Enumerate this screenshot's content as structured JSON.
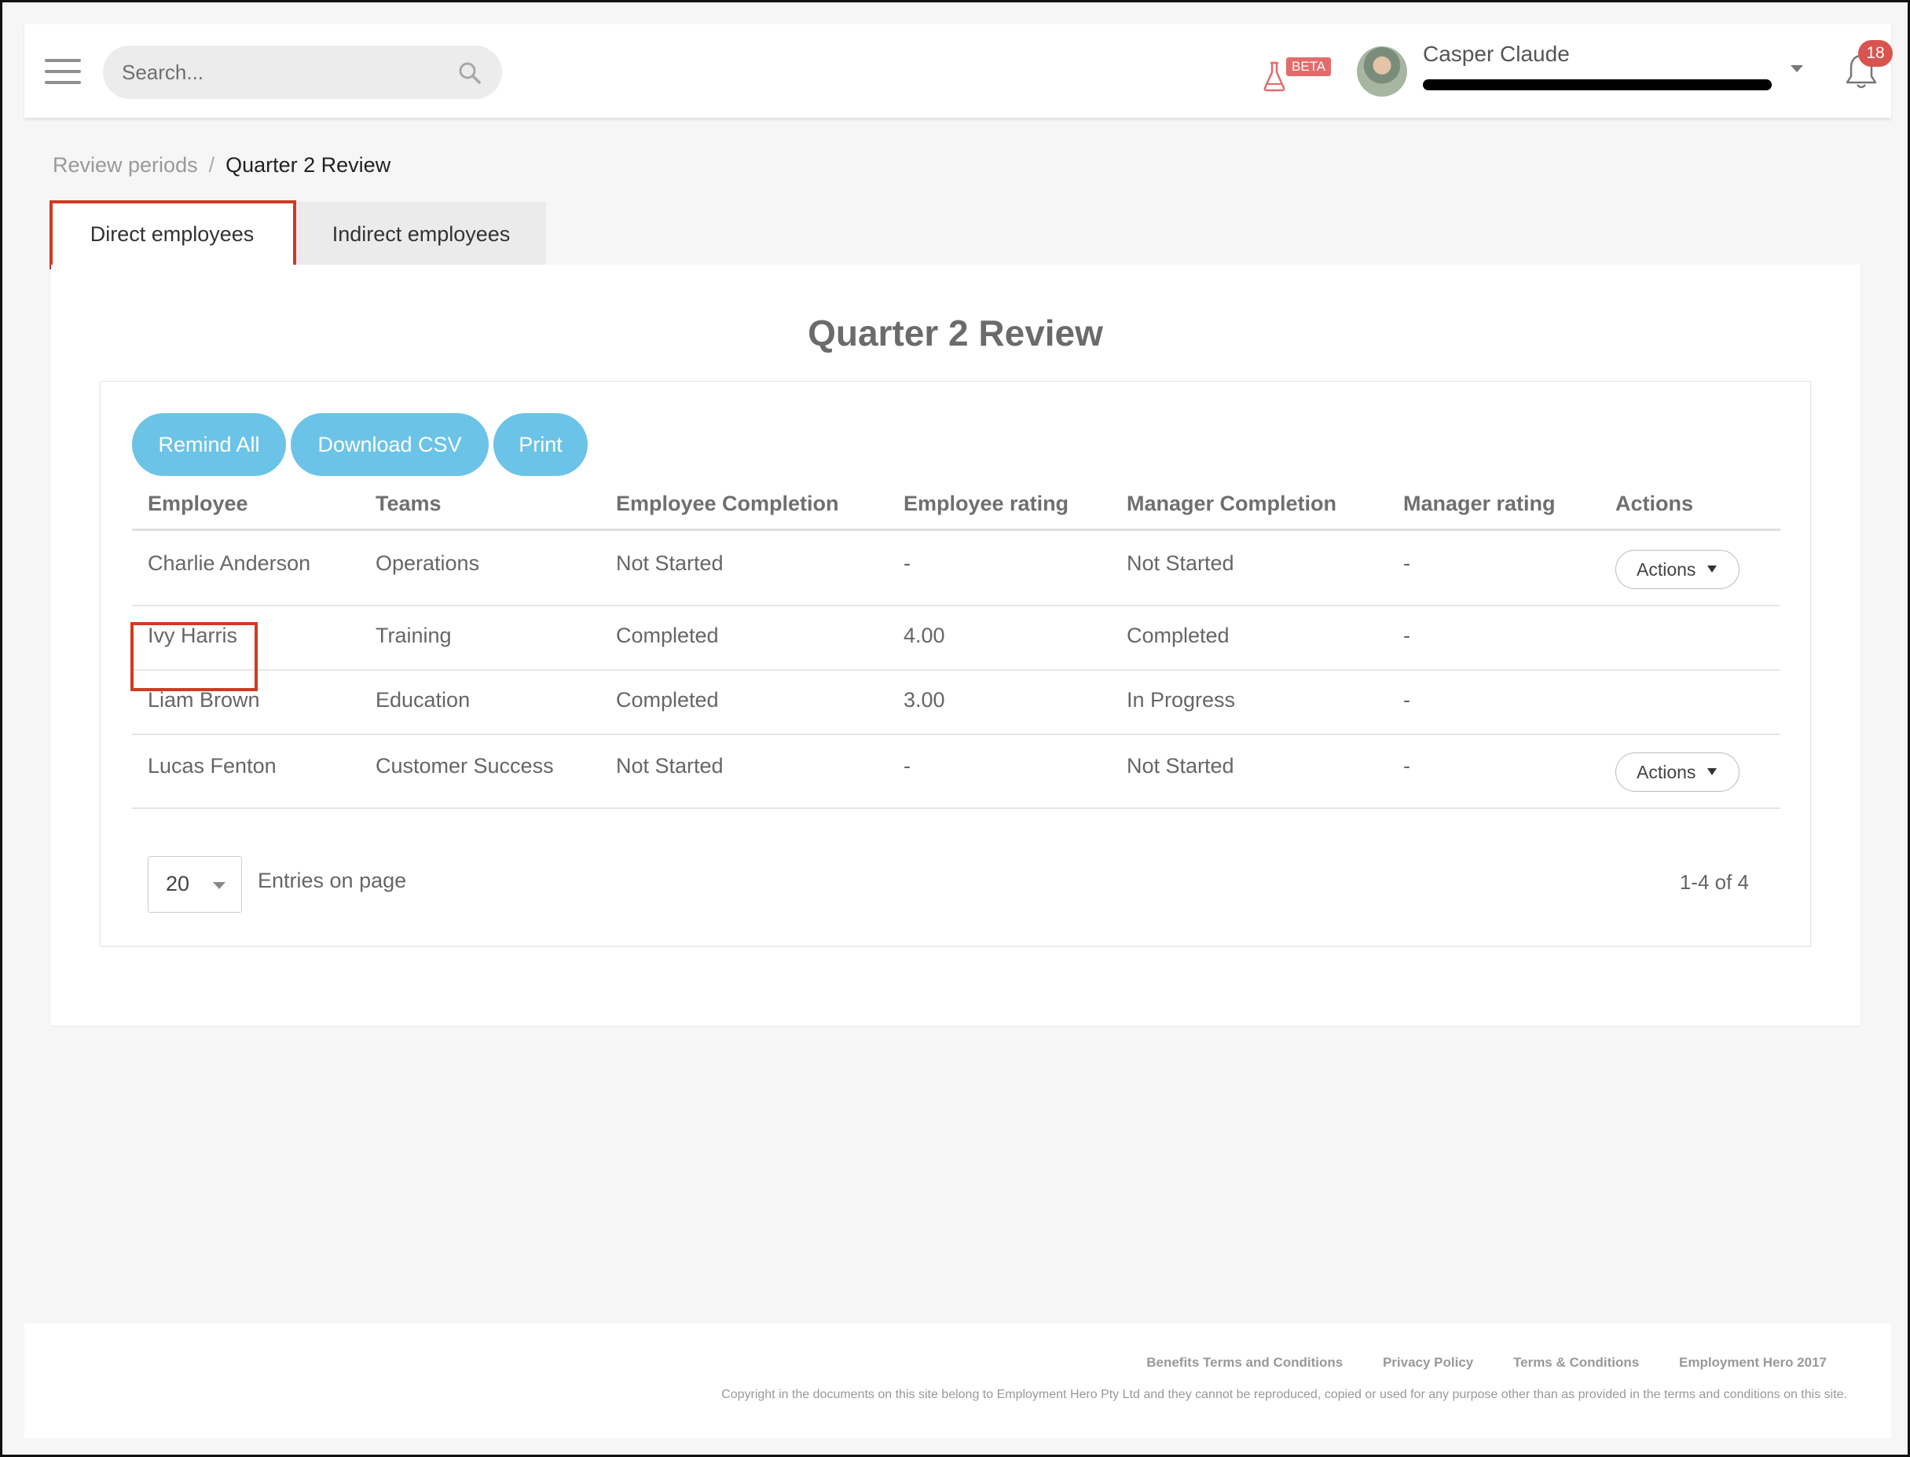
{
  "header": {
    "search_placeholder": "Search...",
    "beta_label": "BETA",
    "user_name": "Casper Claude",
    "notification_count": "18"
  },
  "breadcrumb": {
    "parent": "Review periods",
    "separator": "/",
    "current": "Quarter 2 Review"
  },
  "tabs": [
    {
      "label": "Direct employees",
      "active": true
    },
    {
      "label": "Indirect employees",
      "active": false
    }
  ],
  "main": {
    "title": "Quarter 2 Review",
    "buttons": {
      "remind_all": "Remind All",
      "download_csv": "Download CSV",
      "print": "Print"
    },
    "columns": [
      "Employee",
      "Teams",
      "Employee Completion",
      "Employee rating",
      "Manager Completion",
      "Manager rating",
      "Actions"
    ],
    "rows": [
      {
        "employee": "Charlie Anderson",
        "team": "Operations",
        "employee_completion": "Not Started",
        "employee_rating": "-",
        "manager_completion": "Not Started",
        "manager_rating": "-",
        "action": "Actions"
      },
      {
        "employee": "Ivy Harris",
        "team": "Training",
        "employee_completion": "Completed",
        "employee_rating": "4.00",
        "manager_completion": "Completed",
        "manager_rating": "-",
        "action": ""
      },
      {
        "employee": "Liam Brown",
        "team": "Education",
        "employee_completion": "Completed",
        "employee_rating": "3.00",
        "manager_completion": "In Progress",
        "manager_rating": "-",
        "action": ""
      },
      {
        "employee": "Lucas Fenton",
        "team": "Customer Success",
        "employee_completion": "Not Started",
        "employee_rating": "-",
        "manager_completion": "Not Started",
        "manager_rating": "-",
        "action": "Actions"
      }
    ],
    "pagination": {
      "page_size": "20",
      "entries_label": "Entries on page",
      "range": "1-4 of 4"
    }
  },
  "footer": {
    "links": [
      "Benefits Terms and Conditions",
      "Privacy Policy",
      "Terms & Conditions"
    ],
    "brand": "Employment Hero 2017",
    "copyright": "Copyright in the documents on this site belong to Employment Hero Pty Ltd and they cannot be reproduced, copied or used for any purpose other than as provided in the terms and conditions on this site."
  },
  "colors": {
    "accent_button": "#6cc3e8",
    "highlight_border": "#cf3b22",
    "badge_red": "#d9534f",
    "beta_red": "#e46b6b"
  },
  "icons": [
    "hamburger-menu-icon",
    "search-icon",
    "flask-icon",
    "chevron-down-icon",
    "bell-icon"
  ]
}
